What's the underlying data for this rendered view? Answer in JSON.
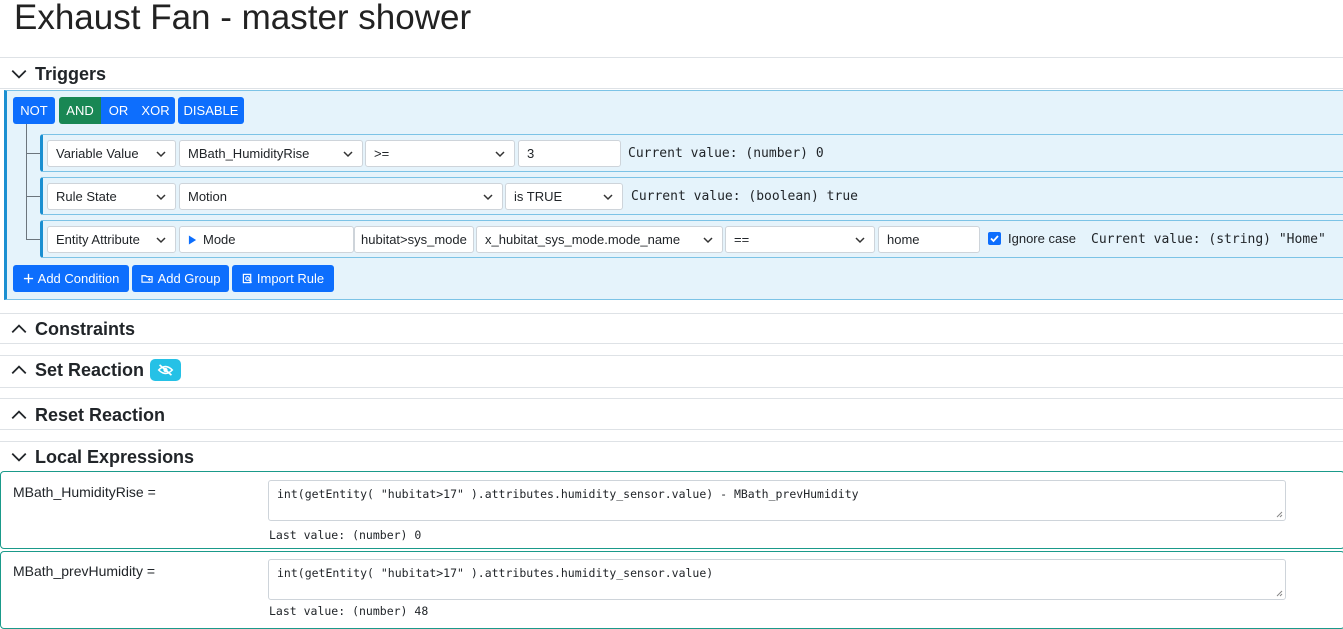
{
  "page": {
    "title": "Exhaust Fan - master shower"
  },
  "sections": {
    "triggers": "Triggers",
    "constraints": "Constraints",
    "set_reaction": "Set Reaction",
    "reset_reaction": "Reset Reaction",
    "local_expressions": "Local Expressions"
  },
  "triggers": {
    "ops": {
      "not": "NOT",
      "and": "AND",
      "or": "OR",
      "xor": "XOR",
      "disable": "DISABLE"
    },
    "conditions": [
      {
        "type": "Variable Value",
        "target": "MBath_HumidityRise",
        "operator": ">=",
        "value": "3",
        "current": "Current value: (number) 0"
      },
      {
        "type": "Rule State",
        "target": "Motion",
        "operator": "is TRUE",
        "current": "Current value: (boolean) true"
      },
      {
        "type": "Entity Attribute",
        "entity": "Mode",
        "entity_id": "hubitat>sys_mode",
        "attribute": "x_hubitat_sys_mode.mode_name",
        "operator": "==",
        "value": "home",
        "ignore_case": "Ignore case",
        "current": "Current value: (string) \"Home\""
      }
    ],
    "buttons": {
      "add_condition": "Add Condition",
      "add_group": "Add Group",
      "import_rule": "Import Rule"
    }
  },
  "local_expressions": [
    {
      "name": "MBath_HumidityRise =",
      "expr": "int(getEntity( \"hubitat>17\" ).attributes.humidity_sensor.value) - MBath_prevHumidity",
      "last": "Last value:  (number) 0"
    },
    {
      "name": "MBath_prevHumidity =",
      "expr": "int(getEntity( \"hubitat>17\" ).attributes.humidity_sensor.value)",
      "last": "Last value:  (number) 48"
    }
  ],
  "colors": {
    "primary": "#0d6efd",
    "success": "#198754",
    "info": "#25c1e6",
    "group_bg": "#e5f3fb",
    "group_border": "#1a8fd1",
    "teal": "#1a9a8a"
  },
  "icons": [
    "chevron-down-icon",
    "chevron-up-icon",
    "eye-slash-icon",
    "plus-icon",
    "add-group-icon",
    "import-icon",
    "play-triangle-icon",
    "check-icon"
  ]
}
